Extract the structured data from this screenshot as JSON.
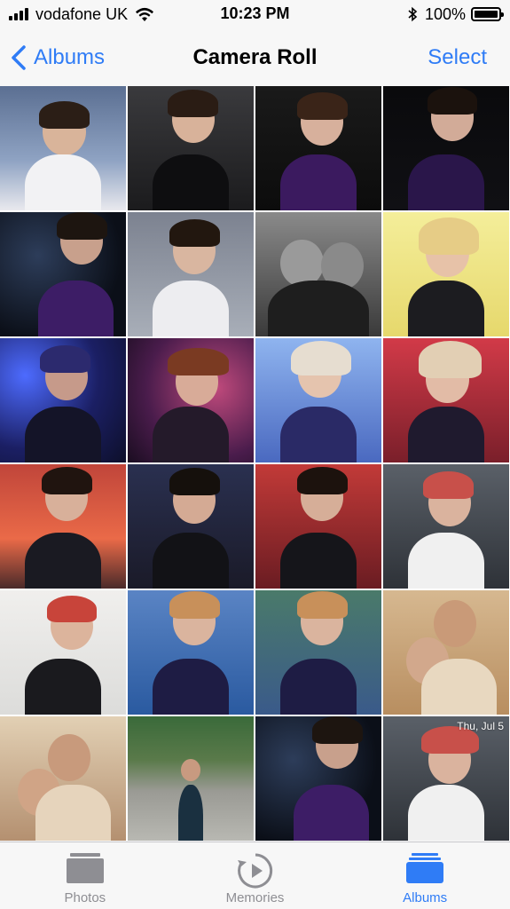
{
  "status_bar": {
    "carrier": "vodafone UK",
    "time": "10:23 PM",
    "battery": "100%"
  },
  "nav": {
    "back_label": "Albums",
    "title": "Camera Roll",
    "select_label": "Select"
  },
  "photo_overlay": {
    "date": "Thu, Jul 5"
  },
  "tabs": [
    {
      "label": "Photos",
      "icon": "photos-icon",
      "active": false
    },
    {
      "label": "Memories",
      "icon": "memories-icon",
      "active": false
    },
    {
      "label": "Albums",
      "icon": "albums-icon",
      "active": true
    }
  ],
  "colors": {
    "accent": "#2f7cf6",
    "inactive": "#8e8e93"
  }
}
